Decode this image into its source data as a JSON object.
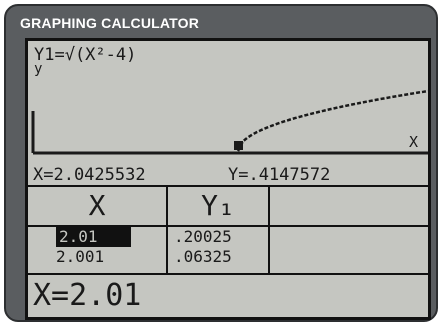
{
  "header": {
    "title": "GRAPHING CALCULATOR"
  },
  "graph": {
    "equation": "Y1=√(X²-4)",
    "y_axis_label": "y",
    "x_axis_label": "X"
  },
  "trace": {
    "x_readout": "X=2.0425532",
    "y_readout": "Y=.4147572"
  },
  "table": {
    "headers": [
      "X",
      "Y₁",
      ""
    ],
    "rows": [
      {
        "x": "2.01",
        "y": ".20025"
      },
      {
        "x": "2.001",
        "y": ".06325"
      }
    ],
    "selected_row": 0
  },
  "entry": {
    "text": "X=2.01"
  },
  "colors": {
    "screen": "#c5c6c1",
    "ink": "#1a1a1a",
    "bezel": "#5a5d60",
    "header_text": "#ffffff"
  }
}
